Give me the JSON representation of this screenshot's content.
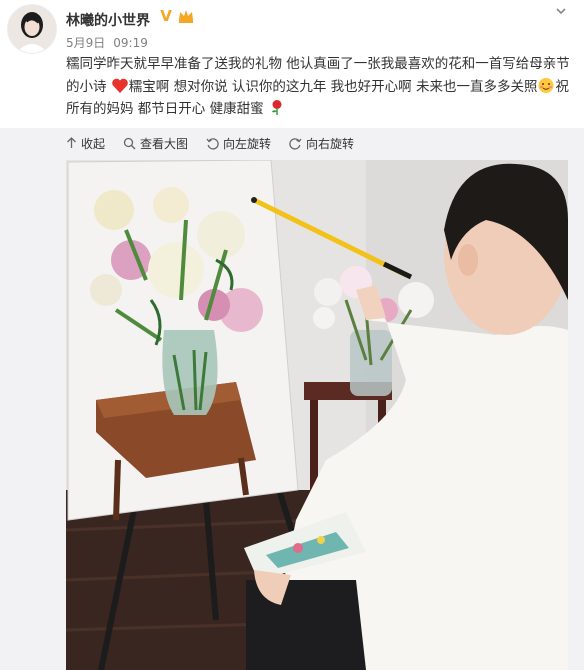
{
  "user": {
    "name": "林曦的小世界",
    "vip_badge": "V"
  },
  "post": {
    "date": "5月9日",
    "time": "09:19",
    "text_part1": "糯同学昨天就早早准备了送我的礼物 他认真画了一张我最喜欢的花和一首写给母亲节的小诗",
    "text_part2": "糯宝啊 想对你说 认识你的这九年 我也好开心啊 未来也一直多多关照",
    "text_part3": "祝所有的妈妈 都节日开心 健康甜蜜"
  },
  "toolbar": {
    "collapse": "收起",
    "view_large": "查看大图",
    "rotate_left": "向左旋转",
    "rotate_right": "向右旋转"
  },
  "icons": {
    "emoji_heart": "red-heart-icon",
    "emoji_smile": "shy-smile-icon",
    "emoji_flower": "rose-icon",
    "chevron": "chevron-down-icon"
  },
  "colors": {
    "accent": "#f5a623",
    "link": "#eb7350",
    "panel": "#f2f2f5"
  }
}
